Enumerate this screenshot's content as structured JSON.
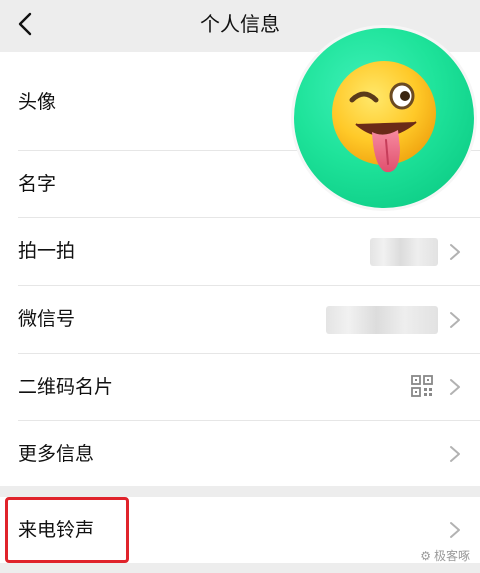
{
  "nav": {
    "title": "个人信息",
    "back_icon": "chevron-left-icon"
  },
  "rows": [
    {
      "label": "头像"
    },
    {
      "label": "名字"
    },
    {
      "label": "拍一拍"
    },
    {
      "label": "微信号"
    },
    {
      "label": "二维码名片"
    },
    {
      "label": "更多信息"
    },
    {
      "label": "来电铃声"
    }
  ],
  "avatar": {
    "description_icon": "winking-tongue-emoji"
  },
  "highlight_color": "#e0232b",
  "watermark": {
    "text": "极客啄"
  }
}
